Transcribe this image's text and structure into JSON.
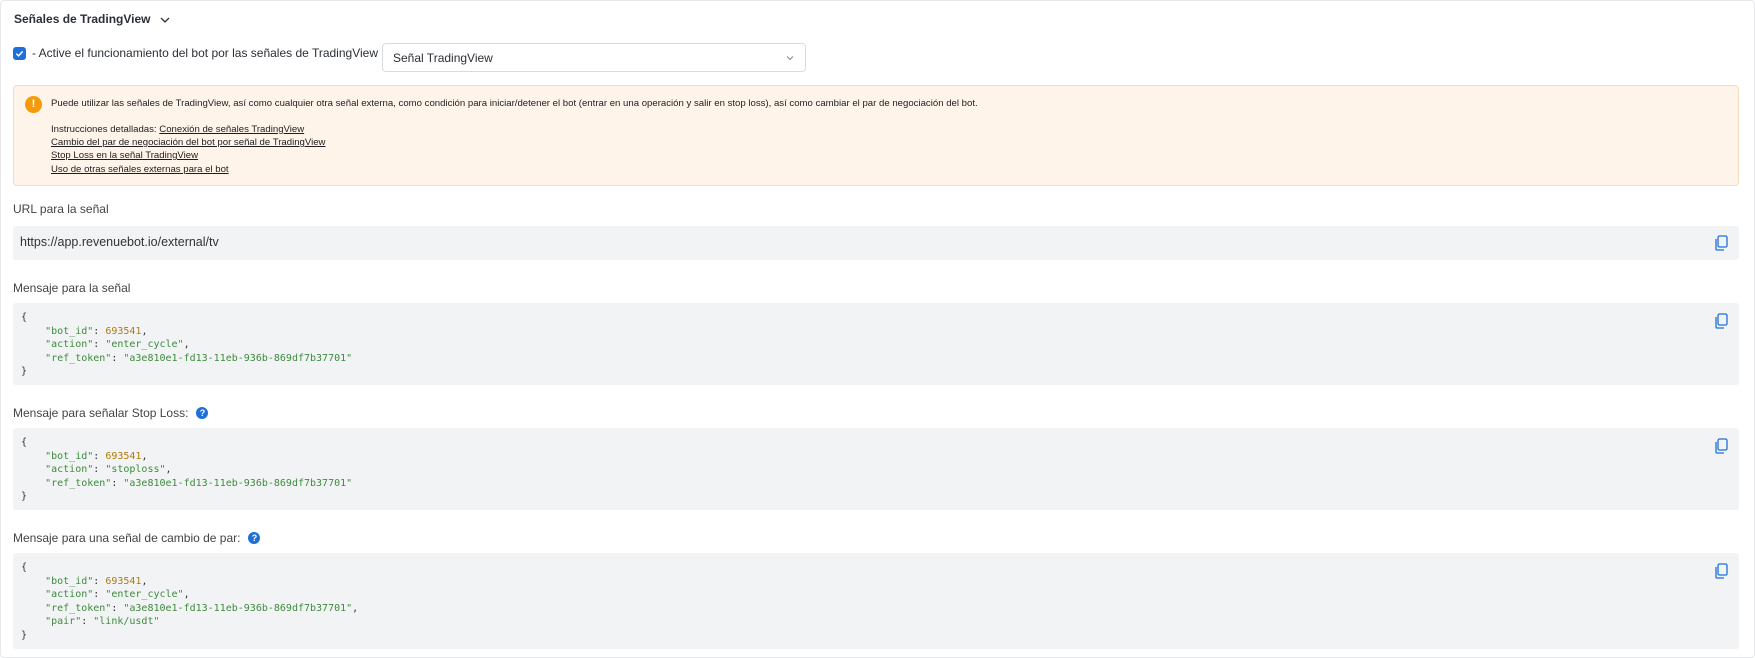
{
  "section": {
    "title": "Señales de TradingView"
  },
  "activation": {
    "checkbox_label": "- Active el funcionamiento del bot por las señales de TradingView",
    "checked": true,
    "select_value": "Señal TradingView"
  },
  "alert": {
    "text": "Puede utilizar las señales de TradingView, así como cualquier otra señal externa, como condición para iniciar/detener el bot (entrar en una operación y salir en stop loss), así como cambiar el par de negociación del bot.",
    "instructions_prefix": "Instrucciones detalladas:",
    "links": [
      "Conexión de señales TradingView",
      "Cambio del par de negociación del bot por señal de TradingView",
      "Stop Loss en la señal TradingView",
      "Uso de otras señales externas para el bot"
    ]
  },
  "url_field": {
    "label": "URL para la señal",
    "value": "https://app.revenuebot.io/external/tv"
  },
  "message": {
    "label": "Mensaje para la señal",
    "bot_id": "693541",
    "action": "\"enter_cycle\"",
    "ref_token": "\"a3e810e1-fd13-11eb-936b-869df7b37701\""
  },
  "stoploss_message": {
    "label": "Mensaje para señalar Stop Loss:",
    "bot_id": "693541",
    "action": "\"stoploss\"",
    "ref_token": "\"a3e810e1-fd13-11eb-936b-869df7b37701\""
  },
  "pair_message": {
    "label": "Mensaje para una señal de cambio de par:",
    "bot_id": "693541",
    "action": "\"enter_cycle\"",
    "ref_token": "\"a3e810e1-fd13-11eb-936b-869df7b37701\"",
    "pair": "\"link/usdt\""
  },
  "code_keys": {
    "bot_id": "\"bot_id\"",
    "action": "\"action\"",
    "ref_token": "\"ref_token\"",
    "pair": "\"pair\""
  },
  "icons": {
    "copy": "copy-icon",
    "help": "question-circle-icon",
    "warning": "exclamation-circle-icon",
    "chevron": "chevron-down-icon",
    "check": "check-icon"
  },
  "colors": {
    "accent": "#1e6fd9",
    "warning": "#f49a0b",
    "alert_bg": "#fff4ea",
    "code_bg": "#f2f3f5"
  }
}
